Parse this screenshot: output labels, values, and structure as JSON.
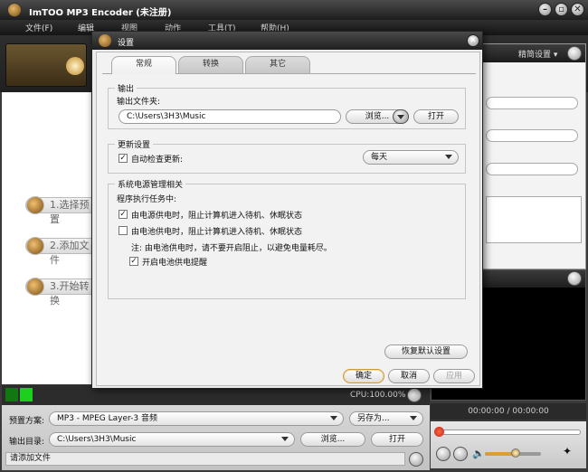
{
  "app": {
    "title": "ImTOO MP3 Encoder (未注册)"
  },
  "menu": [
    "文件(F)",
    "编辑",
    "视图",
    "动作",
    "工具(T)",
    "帮助(H)"
  ],
  "window_buttons": {
    "minimize": "–",
    "restore": "▫",
    "close": "✕"
  },
  "right_panel": {
    "profile_label": "精简设置 ▾"
  },
  "steps": [
    "1.选择预置",
    "2.添加文件",
    "3.开始转换"
  ],
  "status": {
    "cpu": "CPU:100.00%"
  },
  "bottom": {
    "preset_label": "预置方案:",
    "preset_value": "MP3 - MPEG Layer-3 音频",
    "save_as": "另存为...",
    "output_label": "输出目录:",
    "output_value": "C:\\Users\\3H3\\Music",
    "browse": "浏览...",
    "open": "打开",
    "add_file_hint": "请添加文件"
  },
  "player": {
    "time": "00:00:00 / 00:00:00",
    "progress": 0,
    "volume": 0.55
  },
  "dialog": {
    "title": "设置",
    "close": "✕",
    "tabs": [
      "常规",
      "转换",
      "其它"
    ],
    "active_tab": 0,
    "output": {
      "group": "输出",
      "folder_label": "输出文件夹:",
      "folder_value": "C:\\Users\\3H3\\Music",
      "browse": "浏览...",
      "open": "打开"
    },
    "update": {
      "group": "更新设置",
      "auto_check": "自动检查更新:",
      "auto_checked": true,
      "frequency": "每天"
    },
    "power": {
      "group": "系统电源管理相关",
      "during_task": "程序执行任务中:",
      "ac_option": "由电源供电时，阻止计算机进入待机、休眠状态",
      "ac_checked": true,
      "battery_option": "由电池供电时，阻止计算机进入待机、休眠状态",
      "battery_checked": false,
      "note": "注: 由电池供电时，请不要开启阻止，以避免电量耗尽。",
      "battery_reminder": "开启电池供电提醒",
      "reminder_checked": true
    },
    "restore_defaults": "恢复默认设置",
    "ok": "确定",
    "cancel": "取消",
    "apply": "应用"
  }
}
